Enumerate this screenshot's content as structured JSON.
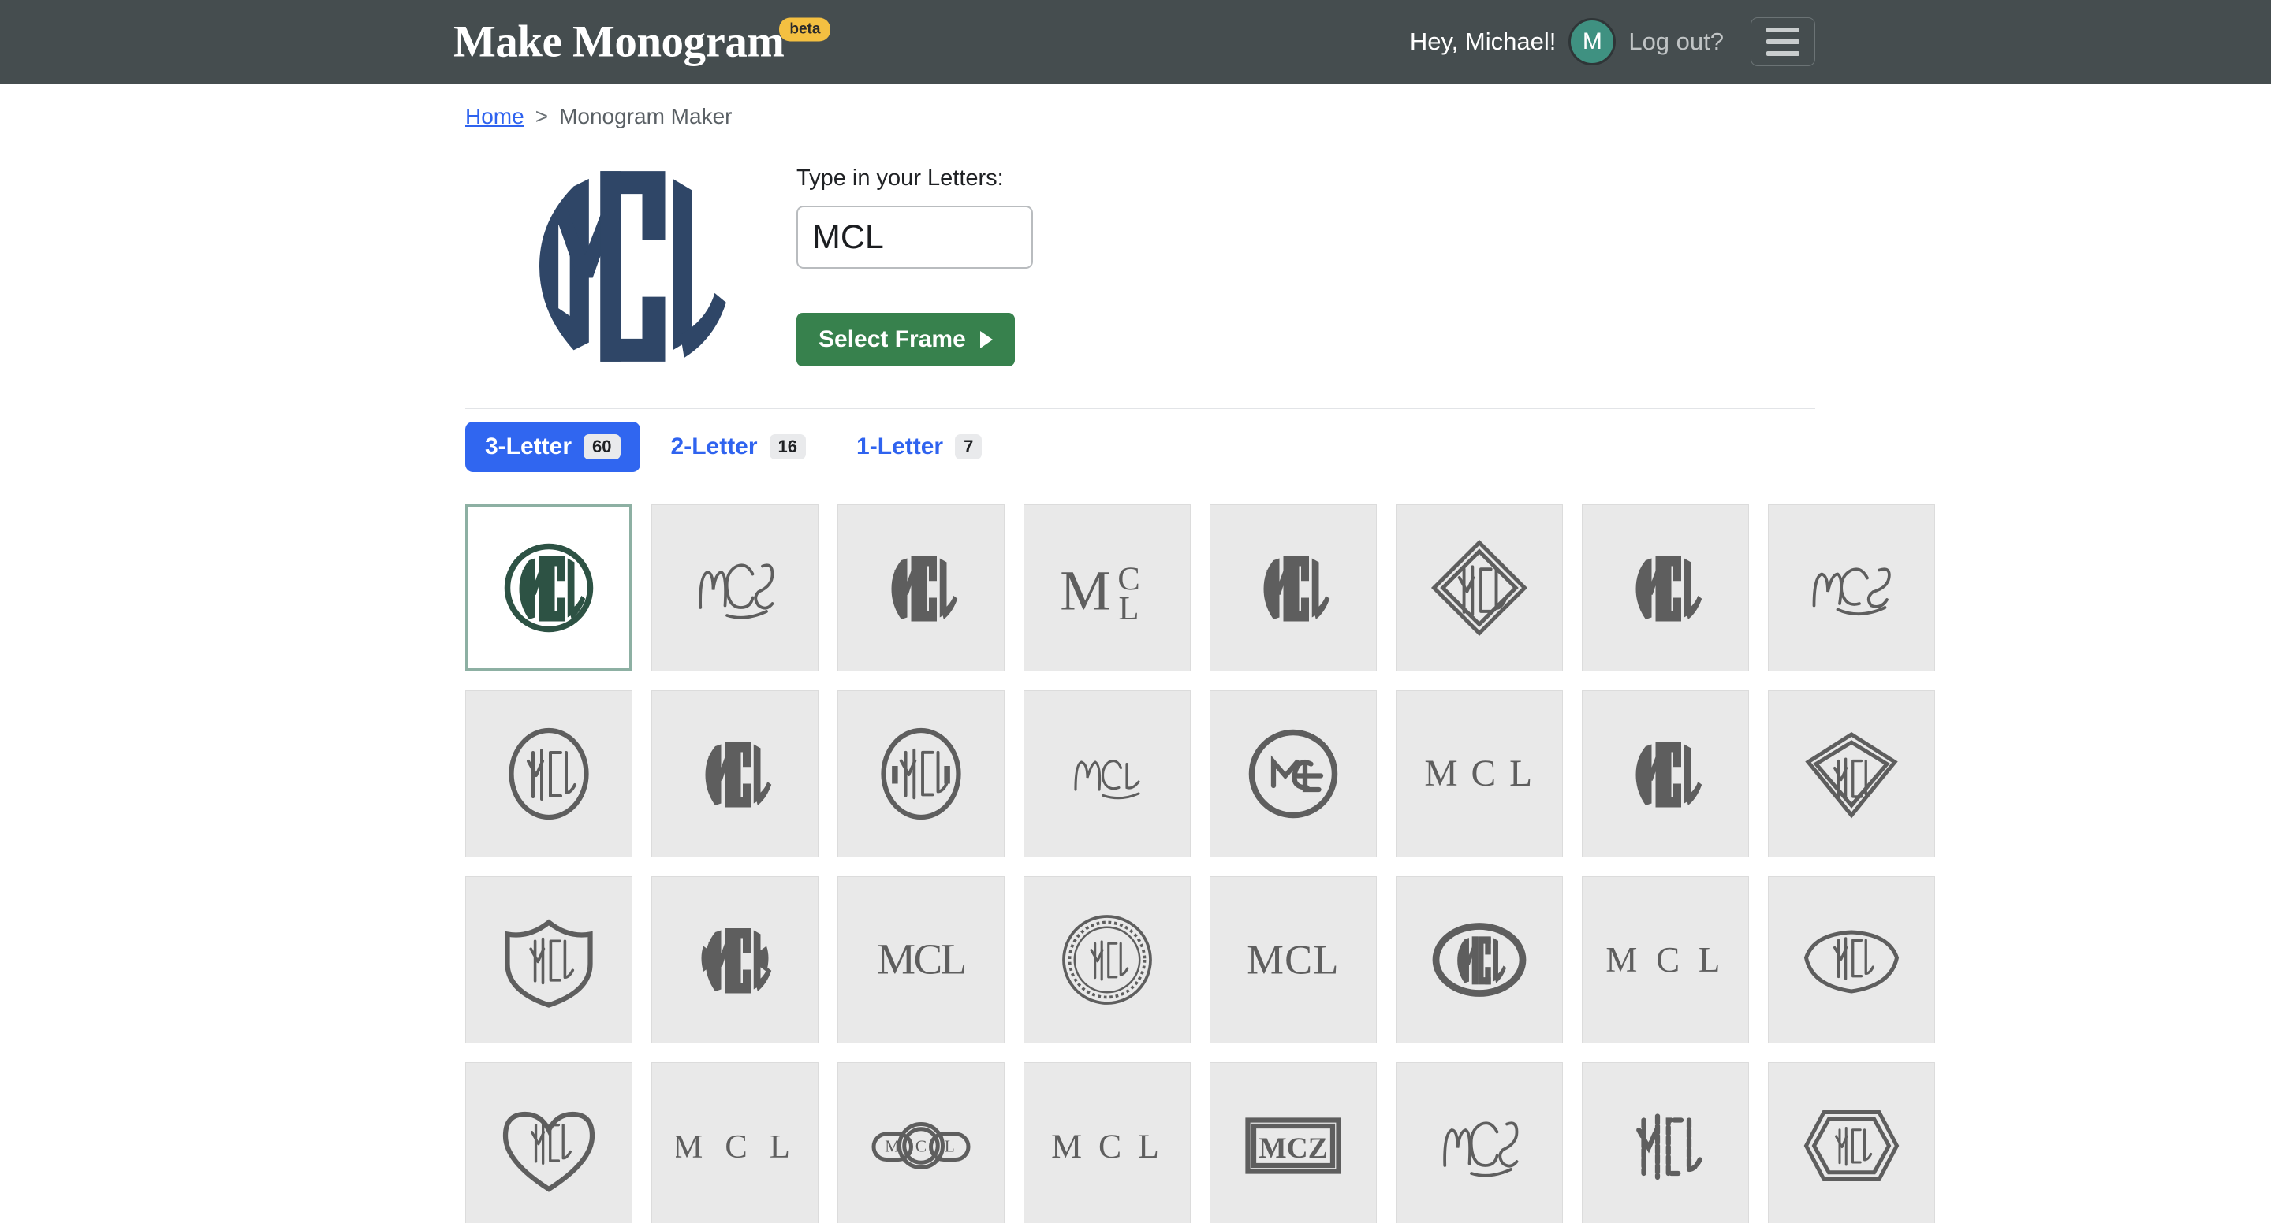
{
  "header": {
    "brand": "Make Monogram",
    "beta_badge": "beta",
    "greeting": "Hey, Michael!",
    "avatar_initial": "M",
    "logout_label": "Log out?",
    "menu_icon": "hamburger-icon",
    "background_color": "#454d4f",
    "avatar_color": "#3f9181",
    "beta_color": "#f4c041"
  },
  "breadcrumb": {
    "home_label": "Home",
    "separator": ">",
    "current": "Monogram Maker"
  },
  "preview": {
    "art_label": "MCL",
    "art_color": "#2f4667"
  },
  "form": {
    "letters_label": "Type in your Letters:",
    "letters_value": "MCL",
    "letters_placeholder": "MCL",
    "select_frame_label": "Select Frame",
    "select_frame_color": "#37814d"
  },
  "tabs": [
    {
      "label": "3-Letter",
      "count": "60",
      "active": true
    },
    {
      "label": "2-Letter",
      "count": "16",
      "active": false
    },
    {
      "label": "1-Letter",
      "count": "7",
      "active": false
    }
  ],
  "grid": {
    "selected_index": 0,
    "selected_border_color": "#8db0a3",
    "tile_background": "#e9e9e9",
    "monogram_color": "#5e5e5e",
    "selected_monogram_color": "#2d5244",
    "tiles": [
      {
        "style": "circle-outline",
        "letters": "MCL"
      },
      {
        "style": "script-flourish",
        "letters": "MCL"
      },
      {
        "style": "circle-solid",
        "letters": "MCL"
      },
      {
        "style": "serif-stacked",
        "letters": "MCL"
      },
      {
        "style": "circle-solid-tall",
        "letters": "MCL"
      },
      {
        "style": "diamond-frame",
        "letters": "MCL"
      },
      {
        "style": "rough-block",
        "letters": "MCL"
      },
      {
        "style": "script-loop",
        "letters": "MCL"
      },
      {
        "style": "oval-outline",
        "letters": "MCL"
      },
      {
        "style": "brush-block",
        "letters": "MCL"
      },
      {
        "style": "circle-deco",
        "letters": "MCL"
      },
      {
        "style": "thin-script",
        "letters": "MCL"
      },
      {
        "style": "circle-interlock",
        "letters": "MCL"
      },
      {
        "style": "plain-serif-wide",
        "letters": "MCL"
      },
      {
        "style": "arch-block",
        "letters": "MCL"
      },
      {
        "style": "shield-diamond",
        "letters": "MCL"
      },
      {
        "style": "shield-frame",
        "letters": "MCL"
      },
      {
        "style": "leaf-circle",
        "letters": "MCL"
      },
      {
        "style": "serif-joined",
        "letters": "MCL"
      },
      {
        "style": "rope-circle",
        "letters": "MCL"
      },
      {
        "style": "serif-caps",
        "letters": "MCL"
      },
      {
        "style": "oval-filled",
        "letters": "MCL"
      },
      {
        "style": "serif-spaced",
        "letters": "MCL"
      },
      {
        "style": "banner-oval",
        "letters": "MCL"
      },
      {
        "style": "heart-frame",
        "letters": "MCL"
      },
      {
        "style": "serif-thin-spaced",
        "letters": "MCL"
      },
      {
        "style": "chain-link",
        "letters": "MCL"
      },
      {
        "style": "serif-plain",
        "letters": "MCL"
      },
      {
        "style": "rect-box",
        "letters": "MCZ"
      },
      {
        "style": "script-vine",
        "letters": "MCL"
      },
      {
        "style": "sketch-block",
        "letters": "MCL"
      },
      {
        "style": "hexagon-frame",
        "letters": "MCL"
      }
    ]
  }
}
